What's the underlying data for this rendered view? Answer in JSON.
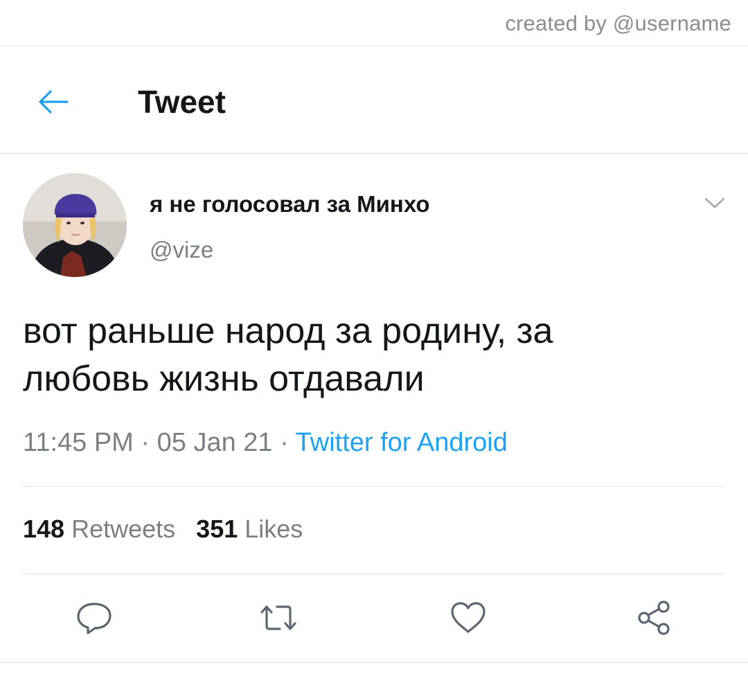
{
  "watermark": "created by @username",
  "header": {
    "title": "Tweet",
    "back_icon": "arrow-left-icon"
  },
  "tweet": {
    "author": {
      "display_name": "я не голосовал за Минхо",
      "handle": "@vize"
    },
    "text_line1": "вот раньше народ за родину, за",
    "text_line2": "любовь жизнь отдавали",
    "time": "11:45 PM",
    "date": "05 Jan 21",
    "separator": " · ",
    "source": "Twitter for Android",
    "retweets_count": "148",
    "retweets_label": "Retweets",
    "likes_count": "351",
    "likes_label": "Likes"
  },
  "actions": {
    "reply_icon": "reply-icon",
    "retweet_icon": "retweet-icon",
    "like_icon": "heart-icon",
    "share_icon": "share-icon"
  },
  "colors": {
    "accent": "#1da1f2",
    "muted": "#7a7f84",
    "text": "#14171a",
    "divider": "#dfe3e6"
  }
}
